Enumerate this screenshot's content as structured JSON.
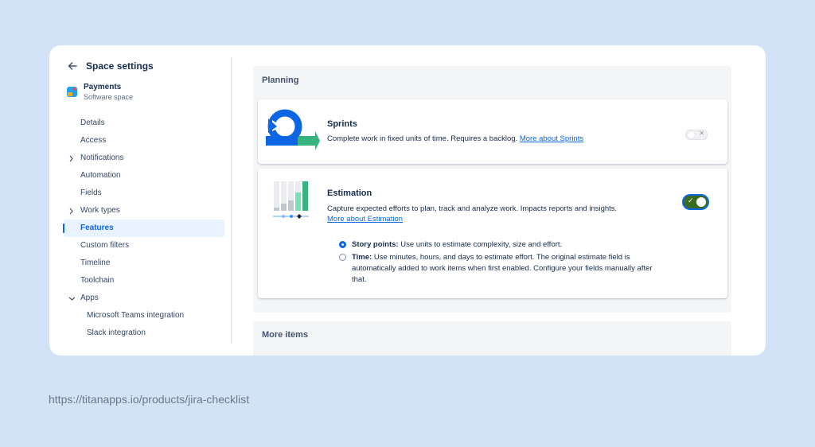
{
  "sidebar": {
    "title": "Space settings",
    "project": {
      "name": "Payments",
      "type": "Software space"
    },
    "items": [
      {
        "label": "Details"
      },
      {
        "label": "Access"
      },
      {
        "label": "Notifications"
      },
      {
        "label": "Automation"
      },
      {
        "label": "Fields"
      },
      {
        "label": "Work types"
      },
      {
        "label": "Features"
      },
      {
        "label": "Custom filters"
      },
      {
        "label": "Timeline"
      },
      {
        "label": "Toolchain"
      },
      {
        "label": "Apps"
      },
      {
        "label": "Microsoft Teams integration"
      },
      {
        "label": "Slack integration"
      }
    ]
  },
  "planning": {
    "title": "Planning",
    "sprints": {
      "title": "Sprints",
      "description": "Complete work in fixed units of time. Requires a backlog.",
      "link": "More about Sprints",
      "enabled": false
    },
    "estimation": {
      "title": "Estimation",
      "description": "Capture expected efforts to plan, track and analyze work. Impacts reports and insights.",
      "link": "More about Estimation",
      "enabled": true,
      "options": [
        {
          "label": "Story points:",
          "description": "Use units to estimate complexity, size and effort.",
          "selected": true
        },
        {
          "label": "Time:",
          "description": "Use minutes, hours, and days to estimate effort. The original estimate field is automatically added to work items when first enabled. Configure your fields manually after that.",
          "selected": false
        }
      ]
    }
  },
  "more_items": {
    "title": "More items"
  },
  "footer": {
    "url": "https://titanapps.io/products/jira-checklist"
  },
  "colors": {
    "background": "#d3e3f7",
    "accent": "#0c66e4",
    "toggle_on": "#3a6b1f"
  }
}
